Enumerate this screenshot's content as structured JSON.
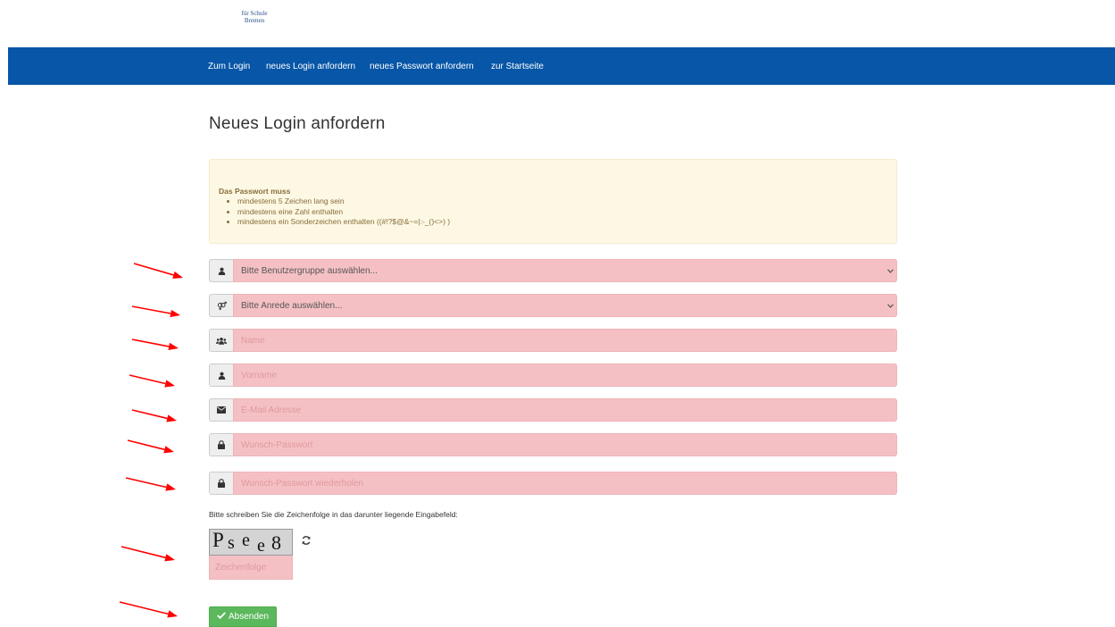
{
  "logo": {
    "line1": "für Schule",
    "line2": "Bremen"
  },
  "nav": {
    "items": [
      {
        "label": "Zum Login"
      },
      {
        "label": "neues Login anfordern"
      },
      {
        "label": "neues Passwort anfordern"
      },
      {
        "label": "zur Startseite"
      }
    ],
    "color": "#0756a7"
  },
  "page": {
    "title": "Neues Login anfordern"
  },
  "alert": {
    "title": "Das Passwort muss",
    "rules": [
      "mindestens 5 Zeichen lang sein",
      "mindestens eine Zahl enthalten",
      "mindestens ein Sonderzeichen enthalten ((#!?$@&~=|:-_()<>) )"
    ]
  },
  "form": {
    "usergroup": {
      "icon": "user-icon",
      "value": "Bitte Benutzergruppe auswählen..."
    },
    "salutation": {
      "icon": "gender-icon",
      "value": "Bitte Anrede auswählen..."
    },
    "name": {
      "icon": "users-icon",
      "placeholder": "Name"
    },
    "firstname": {
      "icon": "user-icon",
      "placeholder": "Vorname"
    },
    "email": {
      "icon": "envelope-icon",
      "placeholder": "E-Mail Adresse"
    },
    "password": {
      "icon": "lock-icon",
      "placeholder": "Wunsch-Passwort"
    },
    "password_repeat": {
      "icon": "lock-icon",
      "placeholder": "Wunsch-Passwort wiederholen"
    }
  },
  "captcha": {
    "instruction": "Bitte schreiben Sie die Zeichenfolge in das darunter liegende Eingabefeld:",
    "code": "Psee8",
    "input_placeholder": "Zeichenfolge",
    "refresh_icon": "refresh-icon"
  },
  "submit": {
    "label": "Absenden",
    "icon": "check-icon",
    "color": "#5cb85c"
  },
  "annotations": {
    "color": "#ff0000"
  }
}
